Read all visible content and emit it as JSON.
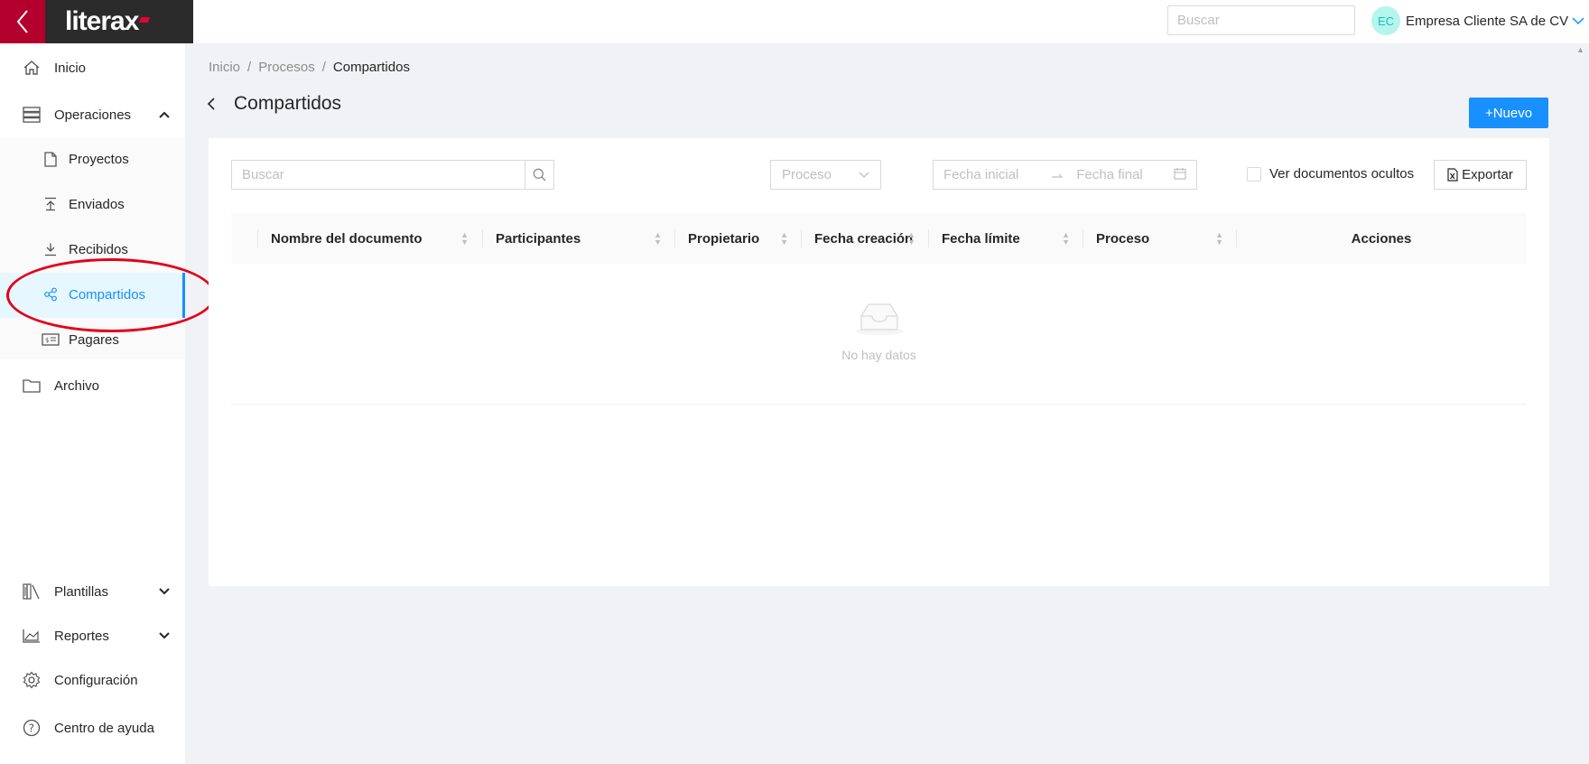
{
  "brand": {
    "name": "literax"
  },
  "header": {
    "search_placeholder": "Buscar",
    "user_initials": "EC",
    "user_name": "Empresa Cliente SA de CV"
  },
  "sidebar": {
    "items": [
      {
        "label": "Inicio",
        "icon": "home-icon"
      },
      {
        "label": "Operaciones",
        "icon": "server-stack-icon"
      },
      {
        "label": "Archivo",
        "icon": "folder-icon"
      },
      {
        "label": "Plantillas",
        "icon": "library-icon"
      },
      {
        "label": "Reportes",
        "icon": "area-chart-icon"
      },
      {
        "label": "Configuración",
        "icon": "gear-icon"
      },
      {
        "label": "Centro de ayuda",
        "icon": "help-circle-icon"
      }
    ],
    "submenu": [
      {
        "label": "Proyectos",
        "icon": "file-icon"
      },
      {
        "label": "Enviados",
        "icon": "upload-icon"
      },
      {
        "label": "Recibidos",
        "icon": "download-icon"
      },
      {
        "label": "Compartidos",
        "icon": "share-icon",
        "active": true
      },
      {
        "label": "Pagares",
        "icon": "money-note-icon"
      }
    ]
  },
  "breadcrumb": [
    "Inicio",
    "Procesos",
    "Compartidos"
  ],
  "page": {
    "title": "Compartidos",
    "new_button": "Nuevo"
  },
  "filters": {
    "search_placeholder": "Buscar",
    "process_placeholder": "Proceso",
    "date_start_placeholder": "Fecha inicial",
    "date_end_placeholder": "Fecha final",
    "hidden_docs_label": "Ver documentos ocultos",
    "hidden_docs_checked": false,
    "export_label": "Exportar"
  },
  "table": {
    "columns": [
      "Nombre del documento",
      "Participantes",
      "Propietario",
      "Fecha creación",
      "Fecha límite",
      "Proceso",
      "Acciones"
    ],
    "empty_text": "No hay datos"
  },
  "colors": {
    "primary": "#1890ff",
    "brand_red": "#b3002d",
    "annotation_red": "#e3001b"
  }
}
